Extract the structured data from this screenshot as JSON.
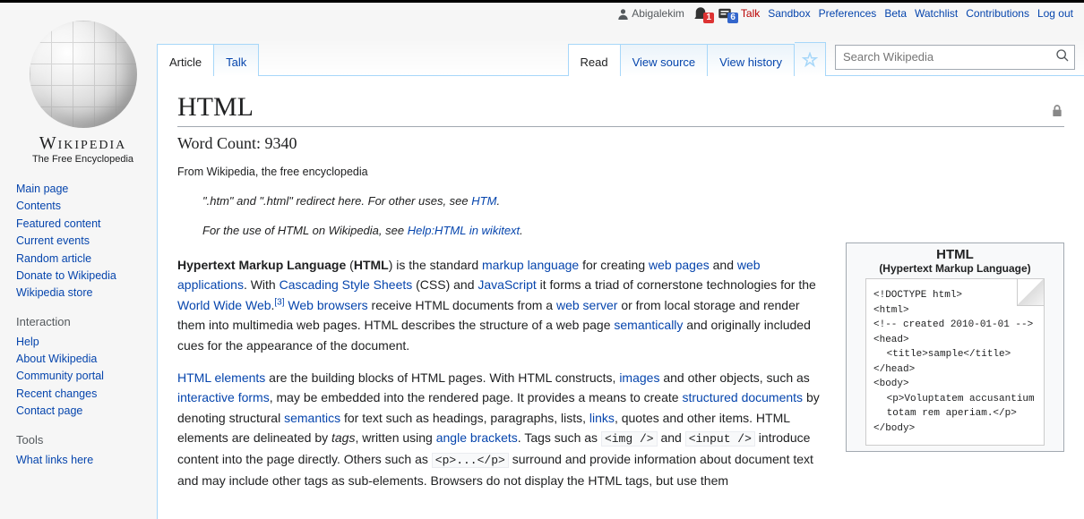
{
  "personal": {
    "user": "Abigalekim",
    "alerts_count": "1",
    "notices_count": "6",
    "links": [
      "Talk",
      "Sandbox",
      "Preferences",
      "Beta",
      "Watchlist",
      "Contributions",
      "Log out"
    ]
  },
  "logo": {
    "wordmark": "Wikipedia",
    "tagline": "The Free Encyclopedia"
  },
  "sidebar": {
    "main": [
      "Main page",
      "Contents",
      "Featured content",
      "Current events",
      "Random article",
      "Donate to Wikipedia",
      "Wikipedia store"
    ],
    "interaction_h": "Interaction",
    "interaction": [
      "Help",
      "About Wikipedia",
      "Community portal",
      "Recent changes",
      "Contact page"
    ],
    "tools_h": "Tools",
    "tools": [
      "What links here"
    ]
  },
  "tabs": {
    "left": [
      {
        "label": "Article",
        "active": true
      },
      {
        "label": "Talk",
        "active": false
      }
    ],
    "right": [
      {
        "label": "Read",
        "active": true
      },
      {
        "label": "View source",
        "active": false
      },
      {
        "label": "View history",
        "active": false
      }
    ]
  },
  "search": {
    "placeholder": "Search Wikipedia"
  },
  "article": {
    "title": "HTML",
    "wordcount": "Word Count: 9340",
    "from": "From Wikipedia, the free encyclopedia",
    "hatnote1_pre": "\".htm\" and \".html\" redirect here. For other uses, see ",
    "hatnote1_link": "HTM",
    "hatnote1_post": ".",
    "hatnote2_pre": "For the use of HTML on Wikipedia, see ",
    "hatnote2_link": "Help:HTML in wikitext",
    "hatnote2_post": ".",
    "p1": {
      "t1": "Hypertext Markup Language",
      "t2": " (",
      "t3": "HTML",
      "t4": ") is the standard ",
      "l1": "markup language",
      "t5": " for creating ",
      "l2": "web pages",
      "t6": " and ",
      "l3": "web applications",
      "t7": ". With ",
      "l4": "Cascading Style Sheets",
      "t8": " (CSS) and ",
      "l5": "JavaScript",
      "t9": " it forms a triad of cornerstone technologies for the ",
      "l6": "World Wide Web",
      "t10": ".",
      "sup": "[3]",
      "t11": " ",
      "l7": "Web browsers",
      "t12": " receive HTML documents from a ",
      "l8": "web server",
      "t13": " or from local storage and render them into multimedia web pages. HTML describes the structure of a web page ",
      "l9": "semantically",
      "t14": " and originally included cues for the appearance of the document."
    },
    "p2": {
      "l1": "HTML elements",
      "t1": " are the building blocks of HTML pages. With HTML constructs, ",
      "l2": "images",
      "t2": " and other objects, such as ",
      "l3": "interactive forms",
      "t3": ", may be embedded into the rendered page. It provides a means to create ",
      "l4": "structured documents",
      "t4": " by denoting structural ",
      "l5": "semantics",
      "t5": " for text such as headings, paragraphs, lists, ",
      "l6": "links",
      "t6": ", quotes and other items. HTML elements are delineated by ",
      "i1": "tags",
      "t7": ", written using ",
      "l7": "angle brackets",
      "t8": ". Tags such as ",
      "c1": "<img />",
      "t9": " and ",
      "c2": "<input />",
      "t10": " introduce content into the page directly. Others such as ",
      "c3": "<p>...</p>",
      "t11": " surround and provide information about document text and may include other tags as sub-elements. Browsers do not display the HTML tags, but use them"
    }
  },
  "infobox": {
    "title": "HTML",
    "subtitle": "(Hypertext Markup Language)",
    "code": [
      "<!DOCTYPE html>",
      "<html>",
      "<!-- created 2010-01-01 -->",
      "<head>",
      " <title>sample</title>",
      "</head>",
      "<body>",
      " <p>Voluptatem accusantium",
      " totam rem aperiam.</p>",
      "</body>"
    ]
  }
}
